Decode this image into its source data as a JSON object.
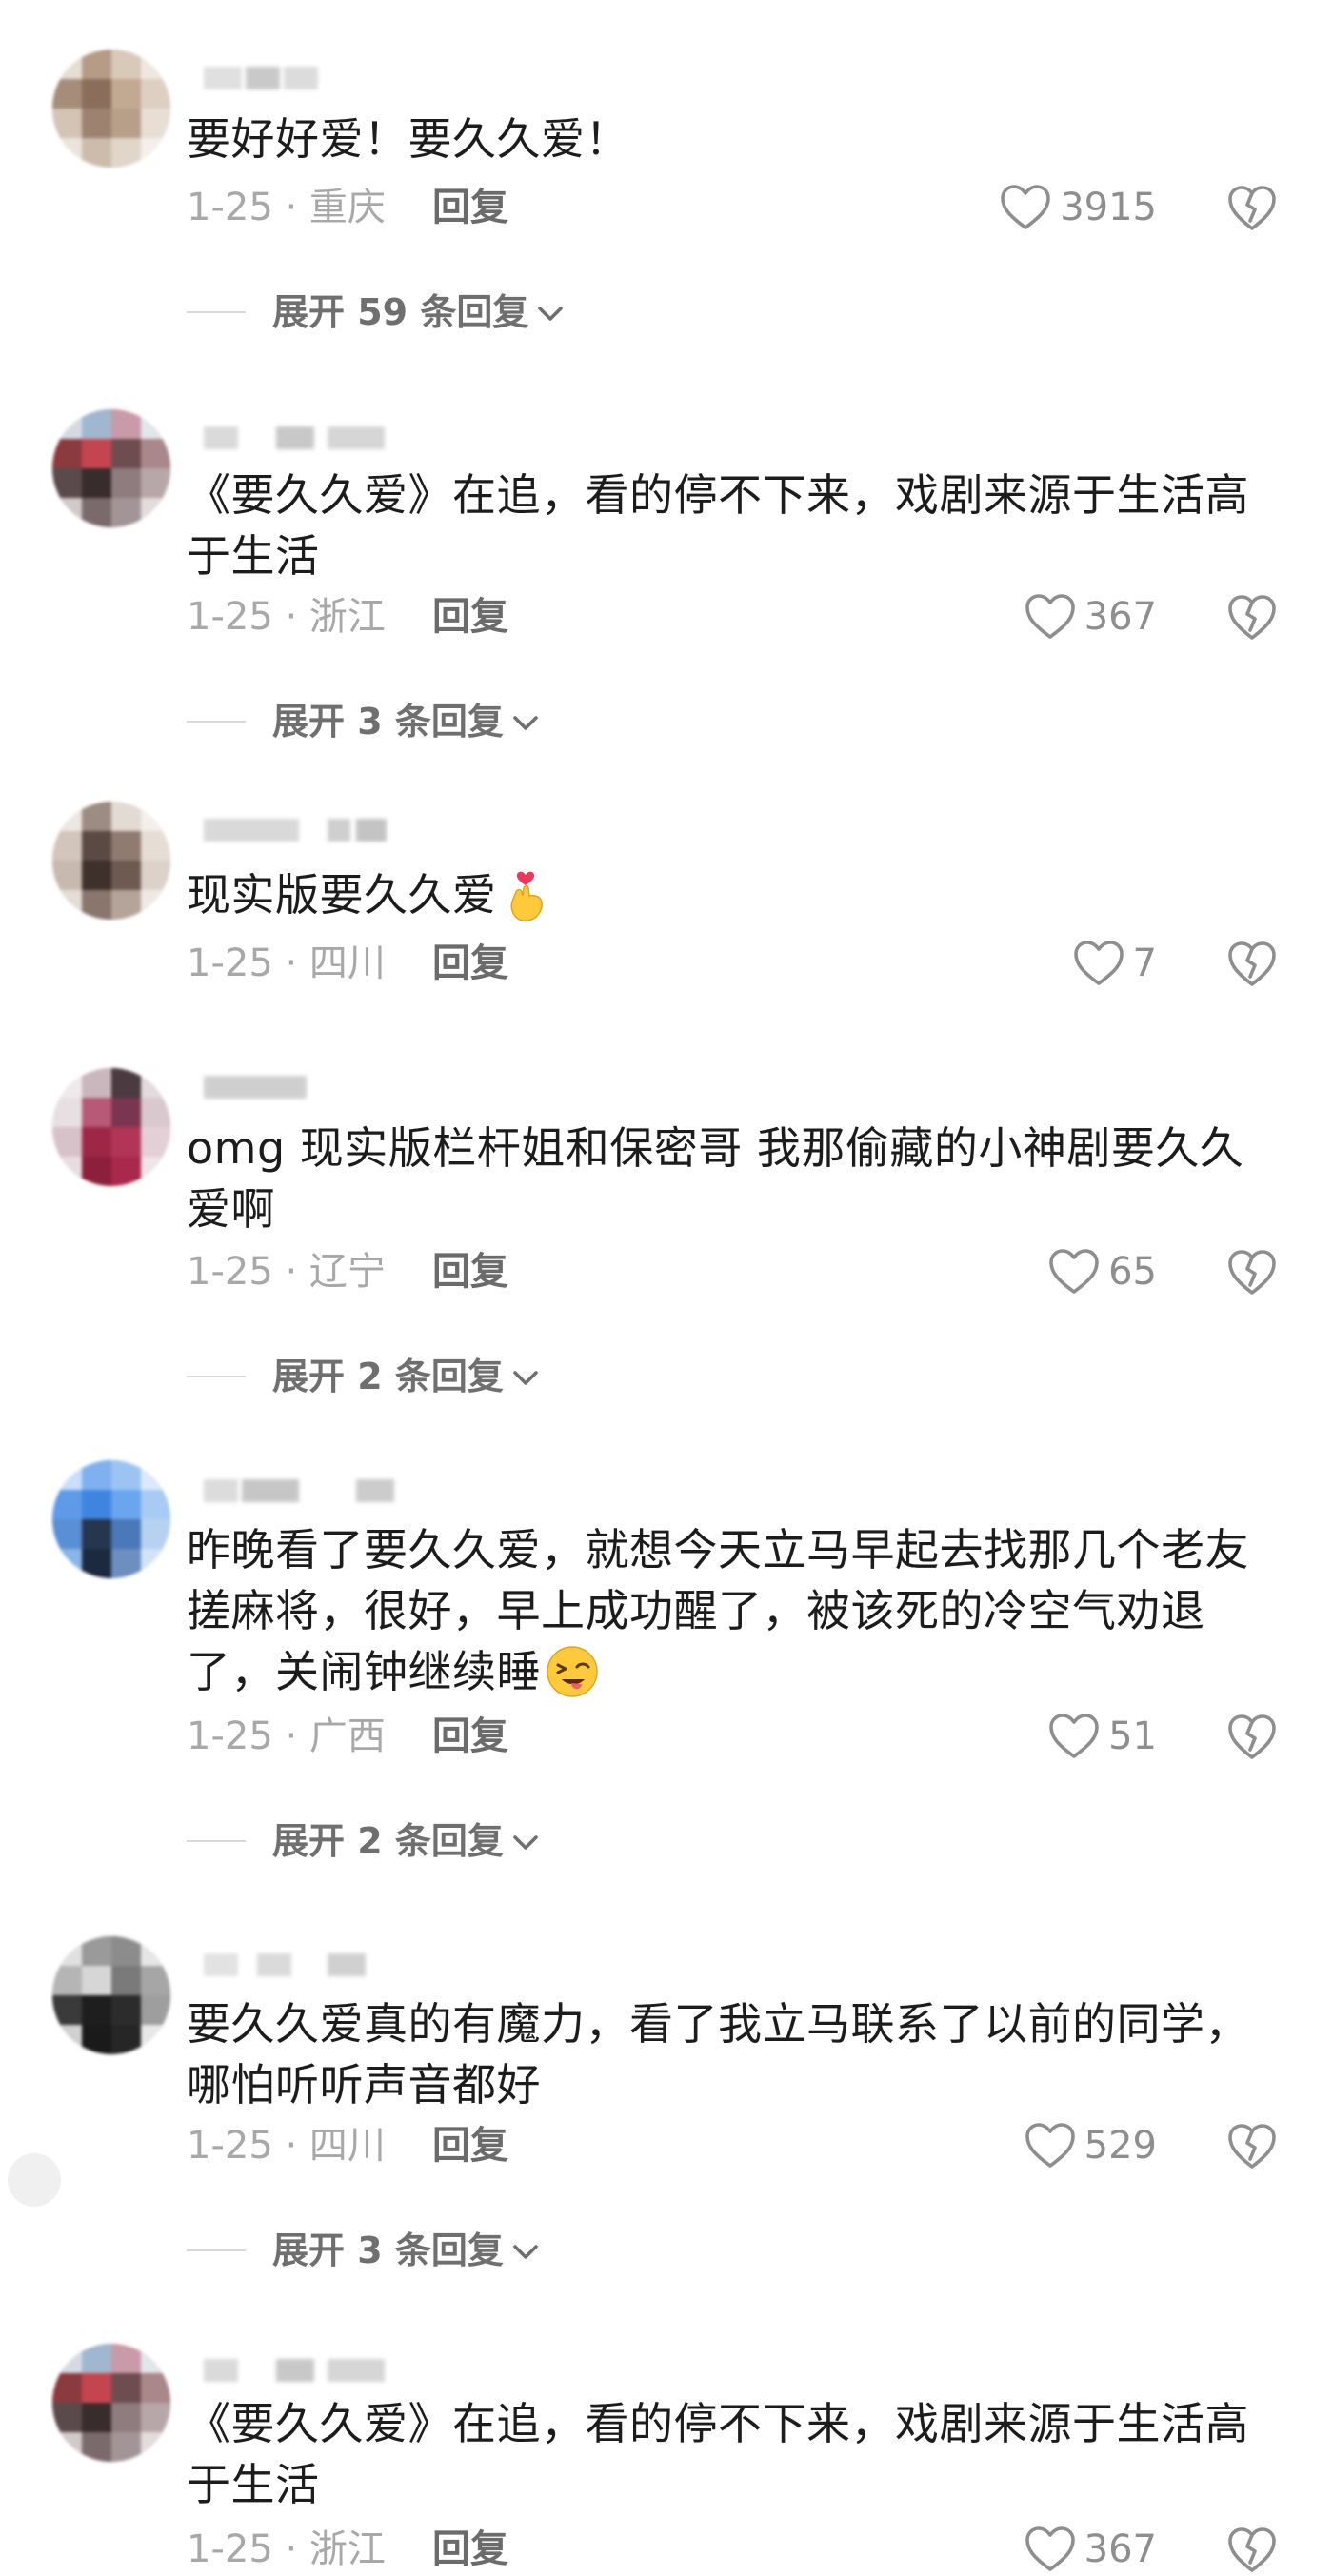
{
  "comments": [
    {
      "text": "要好好爱！要久久爱！",
      "meta": "1-25 · 重庆",
      "reply_label": "回复",
      "likes": "3915",
      "expand": "展开 59 条回复"
    },
    {
      "text": "《要久久爱》在追，看的停不下来，戏剧来源于生活高于生活",
      "meta": "1-25 · 浙江",
      "reply_label": "回复",
      "likes": "367",
      "expand": "展开 3 条回复"
    },
    {
      "text": "现实版要久久爱",
      "emoji": "finger-heart-emoji",
      "meta": "1-25 · 四川",
      "reply_label": "回复",
      "likes": "7"
    },
    {
      "text": "omg 现实版栏杆姐和保密哥 我那偷藏的小神剧要久久爱啊",
      "meta": "1-25 · 辽宁",
      "reply_label": "回复",
      "likes": "65",
      "expand": "展开 2 条回复"
    },
    {
      "text": "昨晚看了要久久爱，就想今天立马早起去找那几个老友搓麻将，很好，早上成功醒了，被该死的冷空气劝退了，关闹钟继续睡",
      "emoji": "winking-tongue-emoji",
      "meta": "1-25 · 广西",
      "reply_label": "回复",
      "likes": "51",
      "expand": "展开 2 条回复"
    },
    {
      "text": "要久久爱真的有魔力，看了我立马联系了以前的同学，哪怕听听声音都好",
      "meta": "1-25 · 四川",
      "reply_label": "回复",
      "likes": "529",
      "expand": "展开 3 条回复"
    },
    {
      "text": "《要久久爱》在追，看的停不下来，戏剧来源于生活高于生活",
      "meta": "1-25 · 浙江",
      "reply_label": "回复",
      "likes": "367"
    }
  ],
  "colors": {
    "text": "#1c1c1c",
    "meta": "#a8a8a8",
    "icon": "#8e8e8e"
  },
  "icons": [
    "heart-icon",
    "dislike-icon",
    "chevron-down-icon"
  ]
}
